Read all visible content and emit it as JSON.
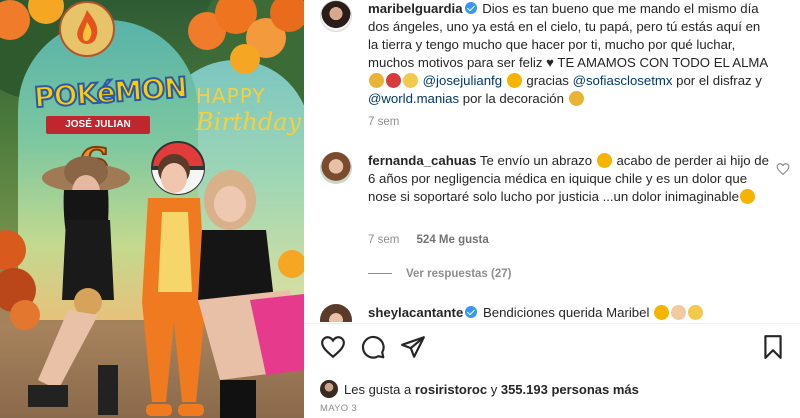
{
  "post": {
    "author": "maribelguardia",
    "caption": "Dios es tan bueno que me mando el mismo día dos ángeles, uno ya está en el cielo, tu papá, pero tú estás aquí en la tierra y tengo mucho que hacer por ti, mucho por qué luchar, muchos motivos para ser feliz",
    "caption_cont": "TE AMAMOS CON TODO EL ALMA",
    "mention1": "@josejulianfg",
    "thanks": "gracias",
    "mention2": "@sofiasclosetmx",
    "por_el_disfraz": "por el disfraz y",
    "mention3": "@world.manias",
    "por_la_decoracion": "por la decoración",
    "time": "7 sem"
  },
  "photo": {
    "brand": "POKéMON",
    "name_ribbon": "JOSÉ JULIAN",
    "number": "6",
    "happy": "HAPPY",
    "birthday": "Birthday"
  },
  "comments": [
    {
      "username": "fernanda_cahuas",
      "text_a": "Te envío un abrazo",
      "text_b": "acabo de perder ai hijo de 6 años por negligencia médica en iquique chile y es un dolor que nose si soportaré solo lucho por justicia ...un dolor inimaginable",
      "time": "7 sem",
      "likes": "524 Me gusta",
      "replies_label": "Ver respuestas (27)"
    },
    {
      "username": "sheylacantante",
      "text": "Bendiciones querida Maribel"
    }
  ],
  "footer": {
    "likes_prefix": "Les gusta a",
    "likes_user": "rosiristoroc",
    "likes_suffix": "y",
    "likes_count": "355.193 personas más",
    "date": "MAYO 3"
  },
  "icons": {
    "like": "heart-icon",
    "comment": "comment-icon",
    "share": "share-icon",
    "save": "bookmark-icon",
    "comment_like": "heart-icon"
  },
  "colors": {
    "link": "#00376b",
    "verified": "#3897f0",
    "muted": "#8e8e8e"
  }
}
